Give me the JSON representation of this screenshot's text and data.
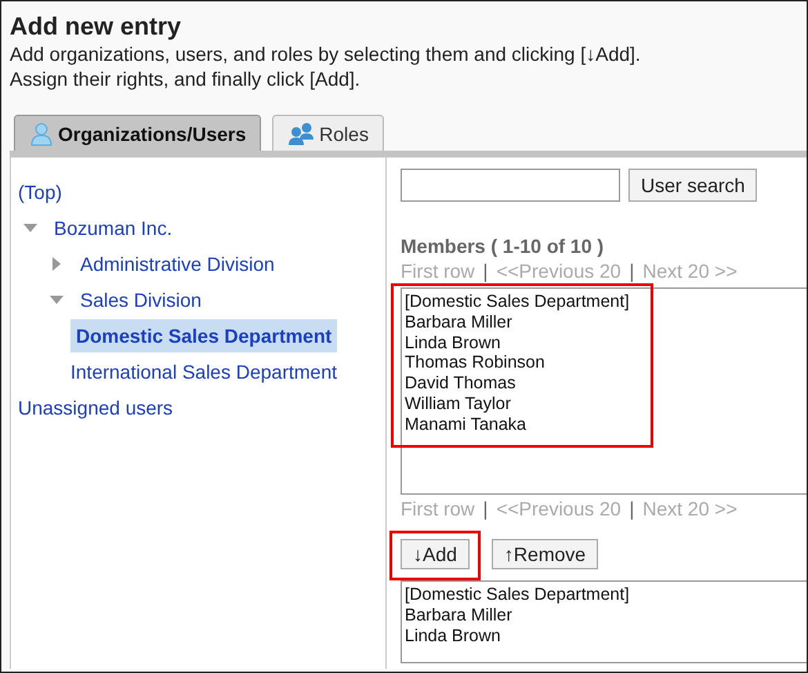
{
  "page": {
    "title": "Add new entry",
    "description": [
      "Add organizations, users, and roles by selecting them and clicking [↓Add].",
      "Assign their rights, and finally click [Add]."
    ]
  },
  "tabs": [
    {
      "label": "Organizations/Users",
      "kind": "user",
      "selected": true
    },
    {
      "label": "Roles",
      "kind": "group",
      "selected": false
    }
  ],
  "tree": [
    {
      "label": "(Top)",
      "selected": false
    },
    {
      "label": "Bozuman Inc.",
      "expanded": true,
      "selected": false,
      "children": [
        {
          "label": "Administrative Division",
          "expanded": false,
          "selected": false
        },
        {
          "label": "Sales Division",
          "expanded": true,
          "selected": false,
          "children": [
            {
              "label": "Domestic Sales Department",
              "selected": true
            },
            {
              "label": "International Sales Department",
              "selected": false
            }
          ]
        }
      ]
    },
    {
      "label": "Unassigned users",
      "selected": false
    }
  ],
  "search": {
    "button": "User search"
  },
  "members": {
    "heading": "Members ( 1-10 of 10 )",
    "highlighted": true,
    "pager_separator": "|",
    "pager_top": [
      {
        "label": "First row",
        "disabled": true
      },
      {
        "label": "<<Previous 20",
        "disabled": true
      },
      {
        "label": "Next 20 >>",
        "disabled": true
      }
    ],
    "items": [
      "[Domestic Sales Department]",
      "Barbara Miller",
      "Linda Brown",
      "Thomas Robinson",
      "David Thomas",
      "William Taylor",
      "Manami Tanaka"
    ],
    "pager_bottom": [
      {
        "label": "First row",
        "disabled": true
      },
      {
        "label": "<<Previous 20",
        "disabled": true
      },
      {
        "label": "Next 20 >>",
        "disabled": true
      }
    ]
  },
  "actions": [
    {
      "label": "↓Add",
      "highlighted": true
    },
    {
      "label": "↑Remove",
      "highlighted": false
    }
  ],
  "selected_list": {
    "items": [
      "[Domestic Sales Department]",
      "Barbara Miller",
      "Linda Brown"
    ]
  }
}
